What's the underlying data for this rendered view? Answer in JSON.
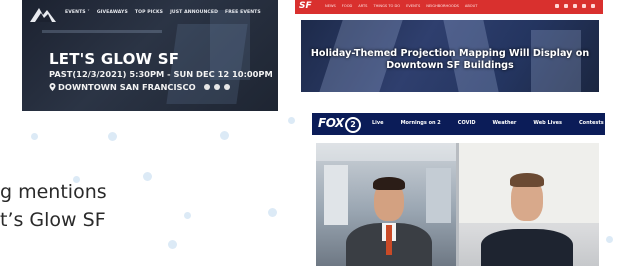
{
  "event_card": {
    "nav_items": [
      "EVENTS ˅",
      "GIVEAWAYS",
      "TOP PICKS",
      "JUST ANNOUNCED",
      "FREE EVENTS"
    ],
    "title": "LET'S GLOW SF",
    "date": "PAST(12/3/2021) 5:30PM - SUN DEC 12 10:00PM",
    "location": "DOWNTOWN SAN FRANCISCO",
    "location_icon": "map-pin-icon"
  },
  "article_card": {
    "brand": "SF",
    "headline": "Holiday-Themed Projection Mapping Will Display on Downtown SF Buildings"
  },
  "video_card": {
    "logo_text": "FOX",
    "logo_number": "2",
    "nav_items": [
      "Live",
      "Mornings on 2",
      "COVID",
      "Weather",
      "Web Lives",
      "Contests"
    ]
  },
  "caption": {
    "line1": "g mentions",
    "line2": "t’s Glow SF"
  },
  "colors": {
    "sfist_red": "#d9302e",
    "fox_navy": "#0b1c58",
    "dot": "#dceaf6"
  }
}
